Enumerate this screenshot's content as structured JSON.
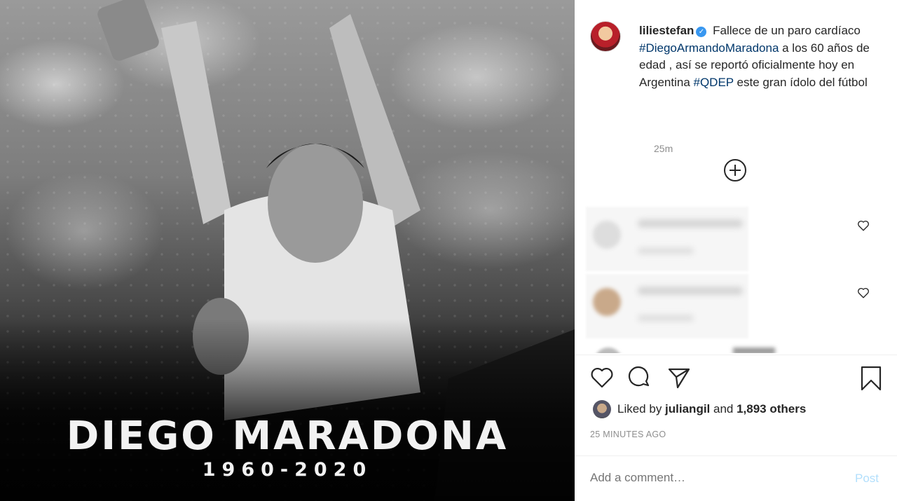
{
  "post": {
    "overlay_name": "DIEGO MARADONA",
    "overlay_years": "1960-2020"
  },
  "caption": {
    "username": "liliestefan",
    "text_1": " Fallece de un paro cardíaco ",
    "hashtag_1": "#DiegoArmandoMaradona",
    "text_2": " a los 60 años de edad , así se reportó oficialmente hoy en Argentina ",
    "hashtag_2": "#QDEP",
    "text_3": " este gran ídolo del fútbol",
    "time": "25m"
  },
  "likes": {
    "prefix": "Liked by ",
    "user": "juliangil",
    "middle": " and ",
    "others": "1,893 others"
  },
  "timestamp": "25 MINUTES AGO",
  "comment_box": {
    "placeholder": "Add a comment…",
    "post_label": "Post"
  },
  "icons": {
    "verified": "verified-badge-icon",
    "add": "plus-circle-icon",
    "like": "heart-icon",
    "comment": "speech-bubble-icon",
    "share": "paper-plane-icon",
    "save": "bookmark-icon"
  },
  "colors": {
    "hashtag": "#00376b",
    "verified": "#3897f0",
    "post_disabled": "#b2dffc",
    "muted": "#8e8e8e"
  }
}
